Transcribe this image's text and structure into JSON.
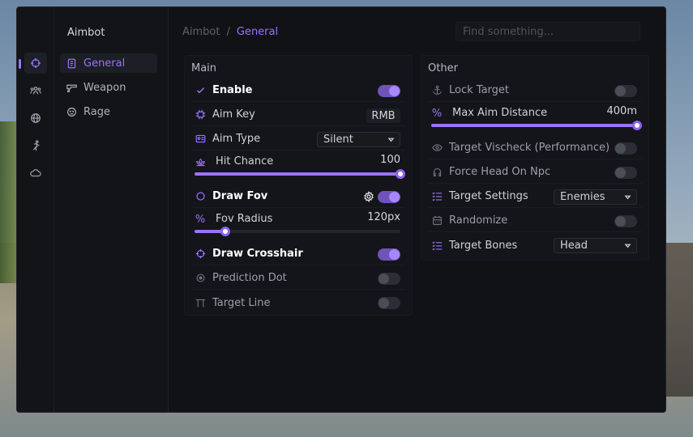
{
  "sidebar": {
    "title": "Aimbot",
    "items": [
      {
        "label": "General",
        "icon": "document-icon"
      },
      {
        "label": "Weapon",
        "icon": "gun-icon"
      },
      {
        "label": "Rage",
        "icon": "face-icon"
      }
    ],
    "rail_icons": [
      "crosshair-icon",
      "users-icon",
      "globe-icon",
      "running-icon",
      "cloud-icon"
    ]
  },
  "breadcrumb": {
    "parent": "Aimbot",
    "separator": "/",
    "current": "General"
  },
  "search": {
    "placeholder": "Find something..."
  },
  "accent_color": "#9d72ff",
  "main_panel": {
    "title": "Main",
    "enable": {
      "label": "Enable",
      "on": true
    },
    "aim_key": {
      "label": "Aim Key",
      "value": "RMB"
    },
    "aim_type": {
      "label": "Aim Type",
      "value": "Silent"
    },
    "hit_chance": {
      "label": "Hit Chance",
      "value": "100",
      "fraction": 1.0
    },
    "draw_fov": {
      "label": "Draw Fov",
      "on": true
    },
    "fov_radius": {
      "label": "Fov Radius",
      "value": "120px",
      "fraction": 0.15
    },
    "draw_crosshair": {
      "label": "Draw Crosshair",
      "on": true
    },
    "prediction_dot": {
      "label": "Prediction Dot",
      "on": false
    },
    "target_line": {
      "label": "Target Line",
      "on": false
    }
  },
  "other_panel": {
    "title": "Other",
    "lock_target": {
      "label": "Lock Target",
      "on": false
    },
    "max_aim_distance": {
      "label": "Max Aim Distance",
      "value": "400m",
      "fraction": 1.0
    },
    "target_vischeck": {
      "label": "Target Vischeck (Performance)",
      "on": false
    },
    "force_head": {
      "label": "Force Head On Npc",
      "on": false
    },
    "target_settings": {
      "label": "Target Settings",
      "value": "Enemies"
    },
    "randomize": {
      "label": "Randomize",
      "on": false
    },
    "target_bones": {
      "label": "Target Bones",
      "value": "Head"
    }
  }
}
